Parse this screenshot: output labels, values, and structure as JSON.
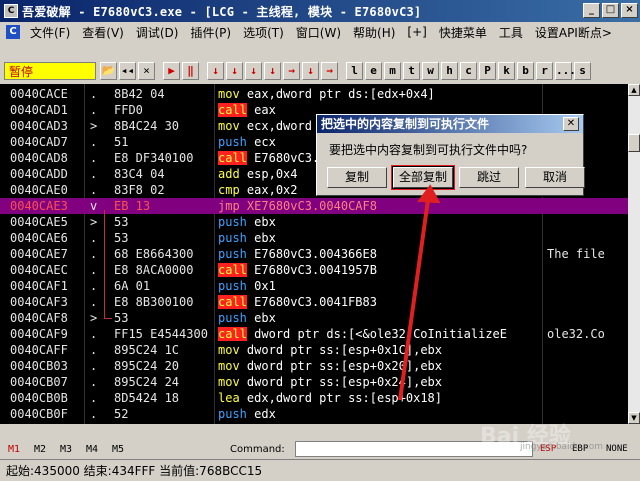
{
  "window": {
    "title": "吾爱破解 - E7680vC3.exe - [LCG - 主线程, 模块 - E7680vC3]",
    "app_icon": "C",
    "buttons": [
      "_",
      "□",
      "×"
    ]
  },
  "menu": {
    "items": [
      "文件(F)",
      "查看(V)",
      "调试(D)",
      "插件(P)",
      "选项(T)",
      "窗口(W)",
      "帮助(H)",
      "[+]",
      "快捷菜单",
      "工具",
      "设置API断点>"
    ]
  },
  "toolbar": {
    "status": "暂停",
    "buttons": [
      "📂",
      "◂◂",
      "×",
      "▶",
      "‖",
      "↓",
      "↓",
      "↓",
      "↓",
      "→",
      "↓",
      "→",
      "l",
      "e",
      "m",
      "t",
      "w",
      "h",
      "c",
      "P",
      "k",
      "b",
      "r",
      "...",
      "s"
    ]
  },
  "disasm": {
    "rows": [
      {
        "addr": "0040CACE",
        "mark": ".",
        "hex": "8B42 04",
        "op": "mov",
        "args": "eax,dword ptr ds:[edx+0x4]",
        "cmt": ""
      },
      {
        "addr": "0040CAD1",
        "mark": ".",
        "hex": "FFD0",
        "op": "call",
        "args": "eax",
        "cmt": ""
      },
      {
        "addr": "0040CAD3",
        "mark": ">",
        "hex": "8B4C24 30",
        "op": "mov",
        "args": "ecx,dword",
        "cmt": ""
      },
      {
        "addr": "0040CAD7",
        "mark": ".",
        "hex": "51",
        "op": "push",
        "args": "ecx",
        "cmt": ""
      },
      {
        "addr": "0040CAD8",
        "mark": ".",
        "hex": "E8 DF340100",
        "op": "call",
        "args": "E7680vC3.",
        "cmt": ""
      },
      {
        "addr": "0040CADD",
        "mark": ".",
        "hex": "83C4 04",
        "op": "add",
        "args": "esp,0x4",
        "cmt": ""
      },
      {
        "addr": "0040CAE0",
        "mark": ".",
        "hex": "83F8 02",
        "op": "cmp",
        "args": "eax,0x2",
        "cmt": ""
      },
      {
        "addr": "0040CAE3",
        "mark": "v",
        "hex": "EB 13",
        "op": "jmp",
        "args": "XE7680vC3.0040CAF8",
        "cmt": ""
      },
      {
        "addr": "0040CAE5",
        "mark": ">",
        "hex": "53",
        "op": "push",
        "args": "ebx",
        "cmt": ""
      },
      {
        "addr": "0040CAE6",
        "mark": ".",
        "hex": "53",
        "op": "push",
        "args": "ebx",
        "cmt": ""
      },
      {
        "addr": "0040CAE7",
        "mark": ".",
        "hex": "68 E8664300",
        "op": "push",
        "args": "E7680vC3.004366E8",
        "cmt": "The file"
      },
      {
        "addr": "0040CAEC",
        "mark": ".",
        "hex": "E8 8ACA0000",
        "op": "call",
        "args": "E7680vC3.0041957B",
        "cmt": ""
      },
      {
        "addr": "0040CAF1",
        "mark": ".",
        "hex": "6A 01",
        "op": "push",
        "args": "0x1",
        "cmt": ""
      },
      {
        "addr": "0040CAF3",
        "mark": ".",
        "hex": "E8 8B300100",
        "op": "call",
        "args": "E7680vC3.0041FB83",
        "cmt": ""
      },
      {
        "addr": "0040CAF8",
        "mark": ">",
        "hex": "53",
        "op": "push",
        "args": "ebx",
        "cmt": ""
      },
      {
        "addr": "0040CAF9",
        "mark": ".",
        "hex": "FF15 E4544300",
        "op": "call",
        "args": "dword ptr ds:[<&ole32.CoInitializeE",
        "cmt": "ole32.Co"
      },
      {
        "addr": "0040CAFF",
        "mark": ".",
        "hex": "895C24 1C",
        "op": "mov",
        "args": "dword ptr ss:[esp+0x1C],ebx",
        "cmt": ""
      },
      {
        "addr": "0040CB03",
        "mark": ".",
        "hex": "895C24 20",
        "op": "mov",
        "args": "dword ptr ss:[esp+0x20],ebx",
        "cmt": ""
      },
      {
        "addr": "0040CB07",
        "mark": ".",
        "hex": "895C24 24",
        "op": "mov",
        "args": "dword ptr ss:[esp+0x24],ebx",
        "cmt": ""
      },
      {
        "addr": "0040CB0B",
        "mark": ".",
        "hex": "8D5424 18",
        "op": "lea",
        "args": "edx,dword ptr ss:[esp+0x18]",
        "cmt": ""
      },
      {
        "addr": "0040CB0F",
        "mark": ".",
        "hex": "52",
        "op": "push",
        "args": "edx",
        "cmt": ""
      }
    ]
  },
  "cmdbar": {
    "tabs": [
      "M1",
      "M2",
      "M3",
      "M4",
      "M5"
    ],
    "command_label": "Command:",
    "right_labels": [
      "ESP",
      "EBP",
      "NONE"
    ]
  },
  "statusbar": {
    "text": "起始:435000 结束:434FFF 当前值:768BCC15"
  },
  "dialog": {
    "title": "把选中的内容复制到可执行文件",
    "message": "要把选中内容复制到可执行文件中吗?",
    "buttons": [
      "复制",
      "全部复制",
      "跳过",
      "取消"
    ]
  },
  "watermark": {
    "brand": "Bai 经验",
    "url": "jingyan.baidu.com"
  },
  "colors": {
    "selection": "#800080",
    "call_bg": "#ff2020",
    "push": "#40a0ff",
    "mov": "#ffff40",
    "annotation": "#e02020"
  }
}
